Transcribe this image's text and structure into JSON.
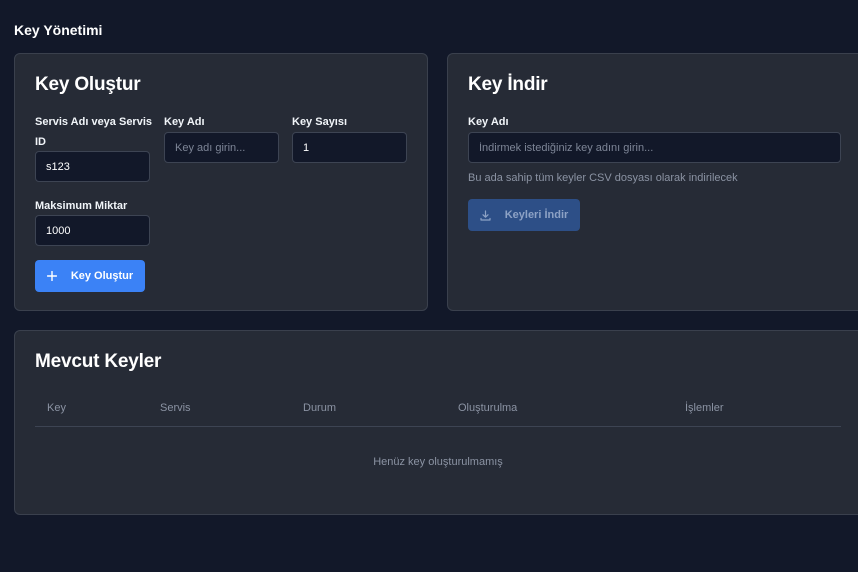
{
  "page": {
    "title": "Key Yönetimi"
  },
  "create": {
    "title": "Key Oluştur",
    "service_label": "Servis Adı veya Servis ID",
    "service_value": "s123",
    "keyname_label": "Key Adı",
    "keyname_placeholder": "Key adı girin...",
    "count_label": "Key Sayısı",
    "count_value": "1",
    "max_label": "Maksimum Miktar",
    "max_value": "1000",
    "button_label": "Key Oluştur",
    "button_icon": "plus-icon"
  },
  "download": {
    "title": "Key İndir",
    "keyname_label": "Key Adı",
    "keyname_placeholder": "İndirmek istediğiniz key adını girin...",
    "hint": "Bu ada sahip tüm keyler CSV dosyası olarak indirilecek",
    "button_label": "Keyleri İndir",
    "button_icon": "download-icon"
  },
  "list": {
    "title": "Mevcut Keyler",
    "columns": [
      "Key",
      "Servis",
      "Durum",
      "Oluşturulma",
      "İşlemler"
    ],
    "empty_text": "Henüz key oluşturulmamış"
  },
  "colors": {
    "background": "#121829",
    "card": "#262b36",
    "primary": "#3b82f6",
    "primary_disabled": "#2d4f87"
  }
}
